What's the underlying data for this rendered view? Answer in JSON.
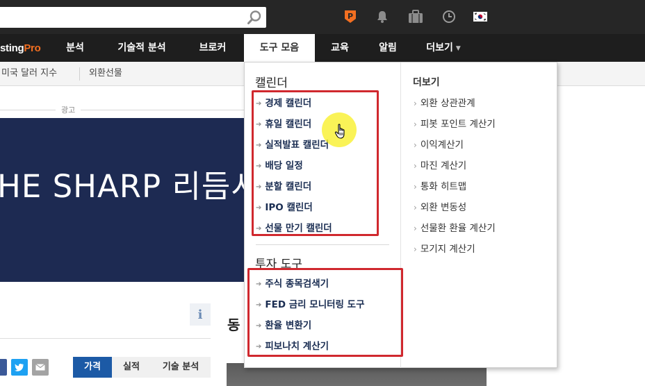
{
  "top_bar": {
    "search": {
      "value": "",
      "placeholder": ""
    },
    "icons": [
      "search-icon",
      "pro-badge-icon",
      "bell-icon",
      "briefcase-icon",
      "clock-icon",
      "korea-flag-icon"
    ]
  },
  "logo": {
    "text_main": "stingPro_prefix",
    "visible_main": "sting",
    "visible_pro": "Pro"
  },
  "nav": {
    "items": [
      {
        "label": "분석"
      },
      {
        "label": "기술적 분석"
      },
      {
        "label": "브로커"
      },
      {
        "label": "도구 모음",
        "active": true
      },
      {
        "label": "교육"
      },
      {
        "label": "알림"
      },
      {
        "label": "더보기"
      }
    ]
  },
  "subnav": {
    "items": [
      {
        "label": "미국 달러 지수"
      },
      {
        "label": "외환선물"
      }
    ]
  },
  "ad": {
    "label": "광고",
    "banner_text": "HE SHARP 리듬시"
  },
  "content": {
    "heading_partial": "동",
    "tabs": [
      {
        "label": "가격"
      },
      {
        "label": "실적"
      },
      {
        "label": "기술 분석"
      }
    ]
  },
  "dropdown": {
    "calendar": {
      "heading": "캘린더",
      "items": [
        {
          "label": "경제 캘린더"
        },
        {
          "label": "휴일 캘린더"
        },
        {
          "label": "실적발표 캘린더"
        },
        {
          "label": "배당 일정"
        },
        {
          "label": "분할 캘린더"
        },
        {
          "label": "IPO 캘린더"
        },
        {
          "label": "선물 만기 캘린더"
        }
      ]
    },
    "tools": {
      "heading": "투자 도구",
      "items": [
        {
          "label": "주식 종목검색기"
        },
        {
          "label": "FED 금리 모니터링 도구"
        },
        {
          "label": "환율 변환기"
        },
        {
          "label": "피보나치 계산기"
        }
      ]
    },
    "more": {
      "heading": "더보기",
      "items": [
        {
          "label": "외환 상관관계"
        },
        {
          "label": "피봇 포인트 계산기"
        },
        {
          "label": "이익계산기"
        },
        {
          "label": "마진 계산기"
        },
        {
          "label": "통화 히트맵"
        },
        {
          "label": "외환 변동성"
        },
        {
          "label": "선물환 환율 계산기"
        },
        {
          "label": "모기지 계산기"
        }
      ]
    }
  },
  "colors": {
    "topbar": "#262626",
    "nav": "#1e1e1e",
    "accent_orange": "#f36f21",
    "banner": "#1d2a52",
    "highlight_red": "#d0282e",
    "link_navy": "#1a2d52",
    "tab_active": "#1c5aa6"
  }
}
